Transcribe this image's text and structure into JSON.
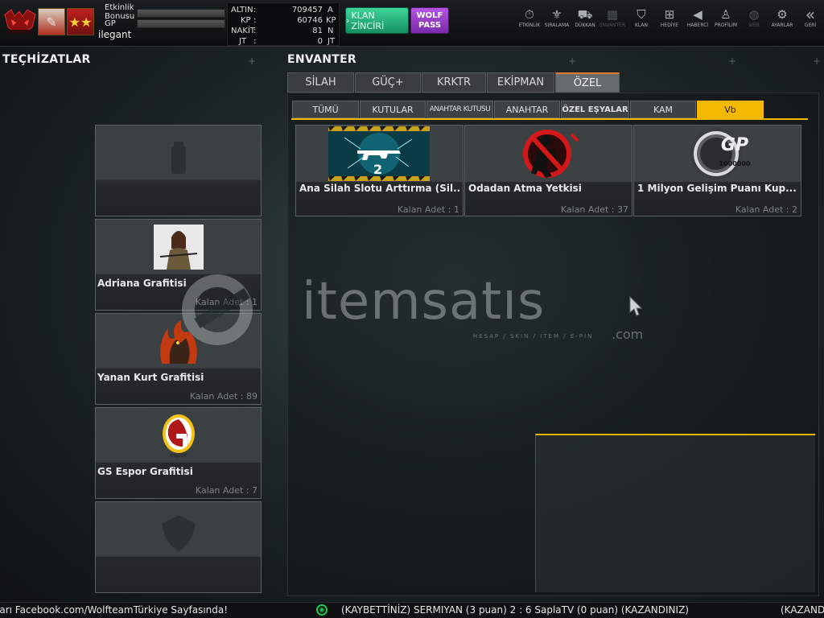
{
  "topbar": {
    "stats": [
      {
        "label": "Etkinlik Bonusu"
      },
      {
        "label": "GP"
      }
    ],
    "username": "ilegant",
    "currencies": [
      {
        "name": "ALTIN",
        "colon": ":",
        "value": "709457",
        "unit": "A"
      },
      {
        "name": "KP",
        "colon": ":",
        "value": "60746",
        "unit": "KP"
      },
      {
        "name": "NAKİT",
        "colon": ":",
        "value": "81",
        "unit": "N"
      },
      {
        "name": "JT",
        "colon": ":",
        "value": "0",
        "unit": "JT"
      }
    ],
    "clan_chain_label": "KLAN ZİNCİRİ",
    "wolf_pass_label_1": "WOLF",
    "wolf_pass_label_2": "PASS",
    "nav": [
      {
        "label": "ETKİNLİK",
        "icon": "stopwatch-icon"
      },
      {
        "label": "SIRALAMA",
        "icon": "medal-icon"
      },
      {
        "label": "DÜKKAN",
        "icon": "cart-icon"
      },
      {
        "label": "ENVANTER",
        "icon": "inventory-icon"
      },
      {
        "label": "KLAN",
        "icon": "shield-icon"
      },
      {
        "label": "HEDİYE",
        "icon": "gift-icon"
      },
      {
        "label": "HABERCİ",
        "icon": "megaphone-icon"
      },
      {
        "label": "PROFİLİM",
        "icon": "profile-icon"
      },
      {
        "label": "WEB",
        "icon": "globe-icon"
      },
      {
        "label": "AYARLAR",
        "icon": "gear-icon"
      },
      {
        "label": "GERİ",
        "icon": "back-icon"
      }
    ]
  },
  "equipment": {
    "title": "TEÇHİZATLAR",
    "slots": [
      {
        "name": "",
        "count": ""
      },
      {
        "name": "Adriana Grafitisi",
        "count": "Kalan Adet : 1"
      },
      {
        "name": "Yanan Kurt Grafitisi",
        "count": "Kalan Adet : 89"
      },
      {
        "name": "GS Espor Grafitisi",
        "count": "Kalan Adet : 7"
      },
      {
        "name": "",
        "count": ""
      }
    ]
  },
  "inventory": {
    "title": "ENVANTER",
    "tabs": [
      "SİLAH",
      "GÜÇ+",
      "KRKTR",
      "EKİPMAN",
      "ÖZEL"
    ],
    "active_tab": "ÖZEL",
    "subtabs": [
      "TÜMÜ",
      "KUTULAR",
      "ANAHTAR KUTUSU",
      "ANAHTAR",
      "ÖZEL EŞYALAR",
      "KAM",
      "Vb"
    ],
    "active_subtab": "Vb",
    "items": [
      {
        "name": "Ana Silah Slotu Arttırma (Sil...",
        "count": "Kalan Adet : 1",
        "badge": "2"
      },
      {
        "name": "Odadan Atma Yetkisi",
        "count": "Kalan Adet : 37"
      },
      {
        "name": "1 Milyon Gelişim Puanı Kup...",
        "count": "Kalan Adet : 2",
        "coin_text": "GP",
        "coin_amount": "1000000"
      }
    ]
  },
  "watermark": {
    "brand": "itemsatıs",
    "tagline": "HESAP / SKIN / ITEM / E-PIN",
    "domain": ".com"
  },
  "ticker": {
    "left_text": "ları Facebook.com/WolfteamTürkiye Sayfasında!",
    "match_text": "(KAYBETTİNİZ) SERMIYAN (3 puan) 2 : 6 SaplaTV (0 puan) (KAZANDINIZ)",
    "right_text": "(KAZAND"
  },
  "colors": {
    "accent": "#f5b800",
    "clan_button": "#1fae74",
    "wolf_pass": "#9a3fcf"
  }
}
